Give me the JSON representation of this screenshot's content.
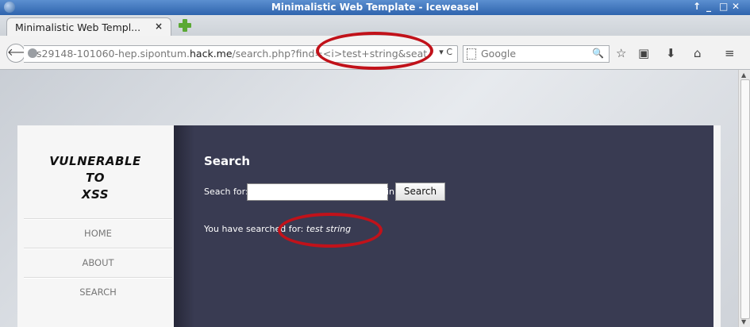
{
  "window": {
    "title": "Minimalistic Web Template - Iceweasel",
    "controls": [
      "↑",
      "_",
      "□",
      "✕"
    ]
  },
  "tab": {
    "label": "Minimalistic Web Templ...",
    "close": "×"
  },
  "address": {
    "prefix": "s29148-101060-hep.sipontum.",
    "host": "hack.me",
    "path": "/search.php?find=<i>test+string&seat",
    "right": "▾ C"
  },
  "search": {
    "placeholder": "Google"
  },
  "toolbar_icons": [
    "star-icon",
    "clipboard-icon",
    "download-icon",
    "home-icon",
    "menu-icon"
  ],
  "page": {
    "logo_line1": "Vulnerable to",
    "logo_line2": "XSS",
    "menu": [
      "HOME",
      "ABOUT",
      "SEARCH"
    ],
    "heading": "Search",
    "search_label": "Seach for:",
    "search_value": "",
    "in_label": "in",
    "search_button": "Search",
    "result_prefix": "You have searched for:",
    "result_value": "test string"
  },
  "colors": {
    "accent_red": "#c1121a",
    "panel_bg": "#393b52",
    "title_bar": "#2f64ad"
  }
}
